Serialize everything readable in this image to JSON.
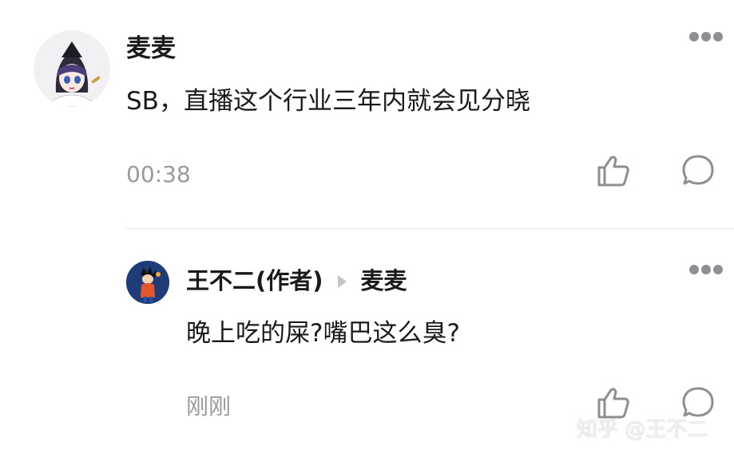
{
  "comment": {
    "username": "麦麦",
    "content": "SB，直播这个行业三年内就会见分晓",
    "time": "00:38"
  },
  "reply": {
    "username": "王不二(作者)",
    "reply_to": "麦麦",
    "content": "晚上吃的屎?嘴巴这么臭?",
    "time": "刚刚"
  },
  "watermark": "知乎 @王不二",
  "icons": {
    "more": "more-dots-icon",
    "like": "thumbs-up-icon",
    "comment": "comment-bubble-icon"
  }
}
